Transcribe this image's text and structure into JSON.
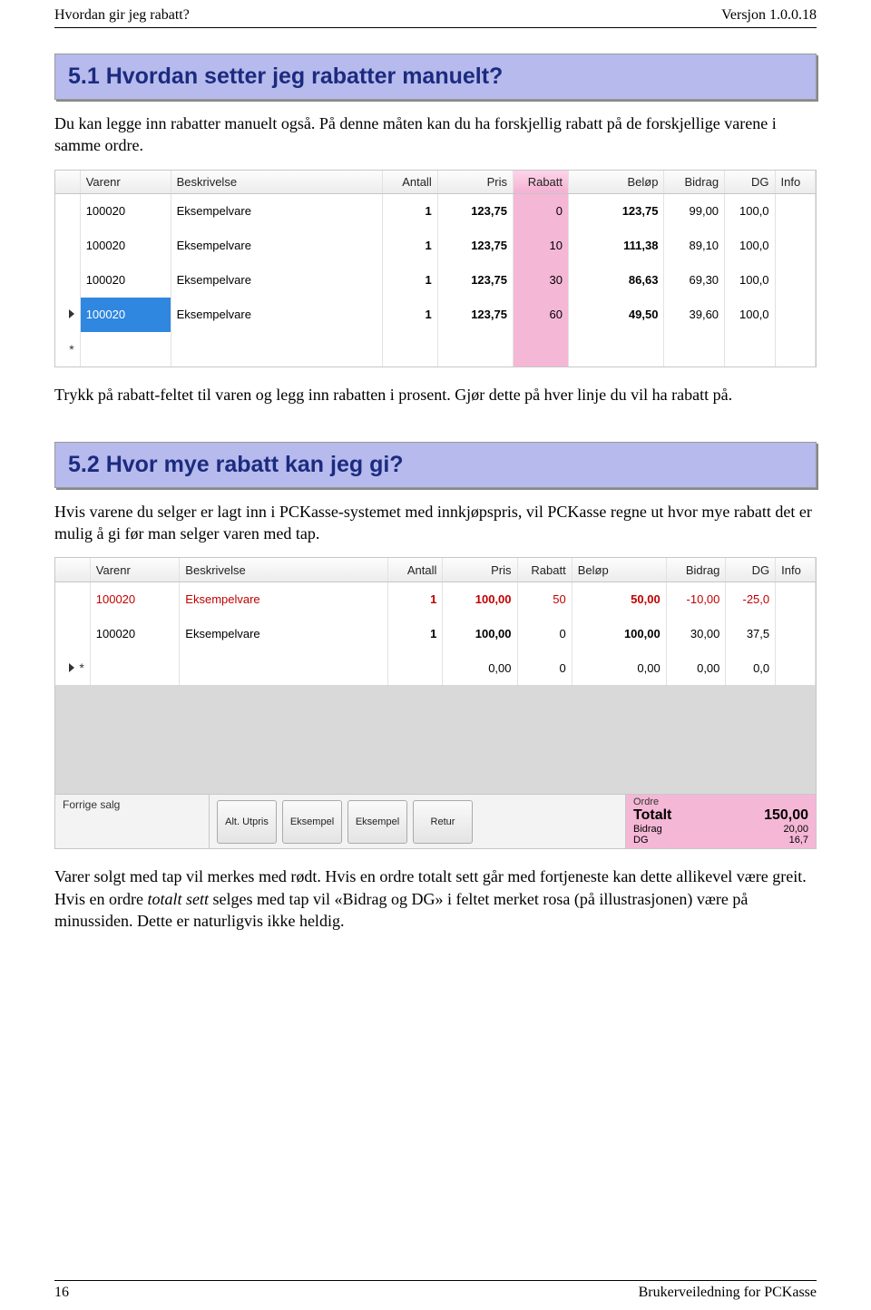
{
  "header": {
    "left": "Hvordan gir jeg rabatt?",
    "right": "Versjon 1.0.0.18"
  },
  "section1": {
    "heading": "5.1  Hvordan setter jeg rabatter manuelt?",
    "para1": "Du kan legge inn rabatter manuelt også. På denne måten kan du ha forskjellig rabatt på de forskjellige varene i samme ordre.",
    "para2": "Trykk på rabatt-feltet til varen og legg inn rabatten i prosent. Gjør dette på hver linje du vil ha rabatt på."
  },
  "grid1": {
    "columns": [
      "",
      "Varenr",
      "Beskrivelse",
      "Antall",
      "Pris",
      "Rabatt",
      "Beløp",
      "Bidrag",
      "DG",
      "Info"
    ],
    "rows": [
      {
        "varenr": "100020",
        "beskriv": "Eksempelvare",
        "antall": "1",
        "pris": "123,75",
        "rabatt": "0",
        "belop": "123,75",
        "bidrag": "99,00",
        "dg": "100,0",
        "selected": false
      },
      {
        "varenr": "100020",
        "beskriv": "Eksempelvare",
        "antall": "1",
        "pris": "123,75",
        "rabatt": "10",
        "belop": "111,38",
        "bidrag": "89,10",
        "dg": "100,0",
        "selected": false
      },
      {
        "varenr": "100020",
        "beskriv": "Eksempelvare",
        "antall": "1",
        "pris": "123,75",
        "rabatt": "30",
        "belop": "86,63",
        "bidrag": "69,30",
        "dg": "100,0",
        "selected": false
      },
      {
        "varenr": "100020",
        "beskriv": "Eksempelvare",
        "antall": "1",
        "pris": "123,75",
        "rabatt": "60",
        "belop": "49,50",
        "bidrag": "39,60",
        "dg": "100,0",
        "selected": true
      }
    ]
  },
  "section2": {
    "heading": "5.2  Hvor mye rabatt kan jeg gi?",
    "para1": "Hvis varene du selger er lagt inn i PCKasse-systemet med innkjøpspris, vil PCKasse regne ut hvor mye rabatt det er mulig å gi før man selger varen med tap.",
    "para2_a": "Varer solgt med tap vil merkes med rødt. Hvis en ordre totalt sett går med fortjeneste kan dette allikevel være greit. Hvis en ordre ",
    "para2_italic": "totalt sett",
    "para2_b": " selges med tap vil «Bidrag og DG» i feltet merket rosa (på illustrasjonen) være på minussiden.  Dette er naturligvis ikke heldig."
  },
  "grid2": {
    "columns": [
      "",
      "Varenr",
      "Beskrivelse",
      "Antall",
      "Pris",
      "Rabatt",
      "Beløp",
      "Bidrag",
      "DG",
      "Info"
    ],
    "rows": [
      {
        "type": "red",
        "varenr": "100020",
        "beskriv": "Eksempelvare",
        "antall": "1",
        "pris": "100,00",
        "rabatt": "50",
        "belop": "50,00",
        "bidrag": "-10,00",
        "dg": "-25,0"
      },
      {
        "type": "normal",
        "varenr": "100020",
        "beskriv": "Eksempelvare",
        "antall": "1",
        "pris": "100,00",
        "rabatt": "0",
        "belop": "100,00",
        "bidrag": "30,00",
        "dg": "37,5"
      },
      {
        "type": "edit",
        "varenr": "",
        "beskriv": "",
        "antall": "",
        "pris": "0,00",
        "rabatt": "0",
        "belop": "0,00",
        "bidrag": "0,00",
        "dg": "0,0"
      }
    ]
  },
  "bottombar": {
    "forrige_label": "Forrige salg",
    "buttons": [
      "Alt. Utpris",
      "Eksempel",
      "Eksempel",
      "Retur"
    ],
    "ordre": {
      "title": "Ordre",
      "totalt_label": "Totalt",
      "totalt_value": "150,00",
      "bidrag_label": "Bidrag",
      "bidrag_value": "20,00",
      "dg_label": "DG",
      "dg_value": "16,7"
    }
  },
  "footer": {
    "page": "16",
    "right": "Brukerveiledning for PCKasse"
  }
}
